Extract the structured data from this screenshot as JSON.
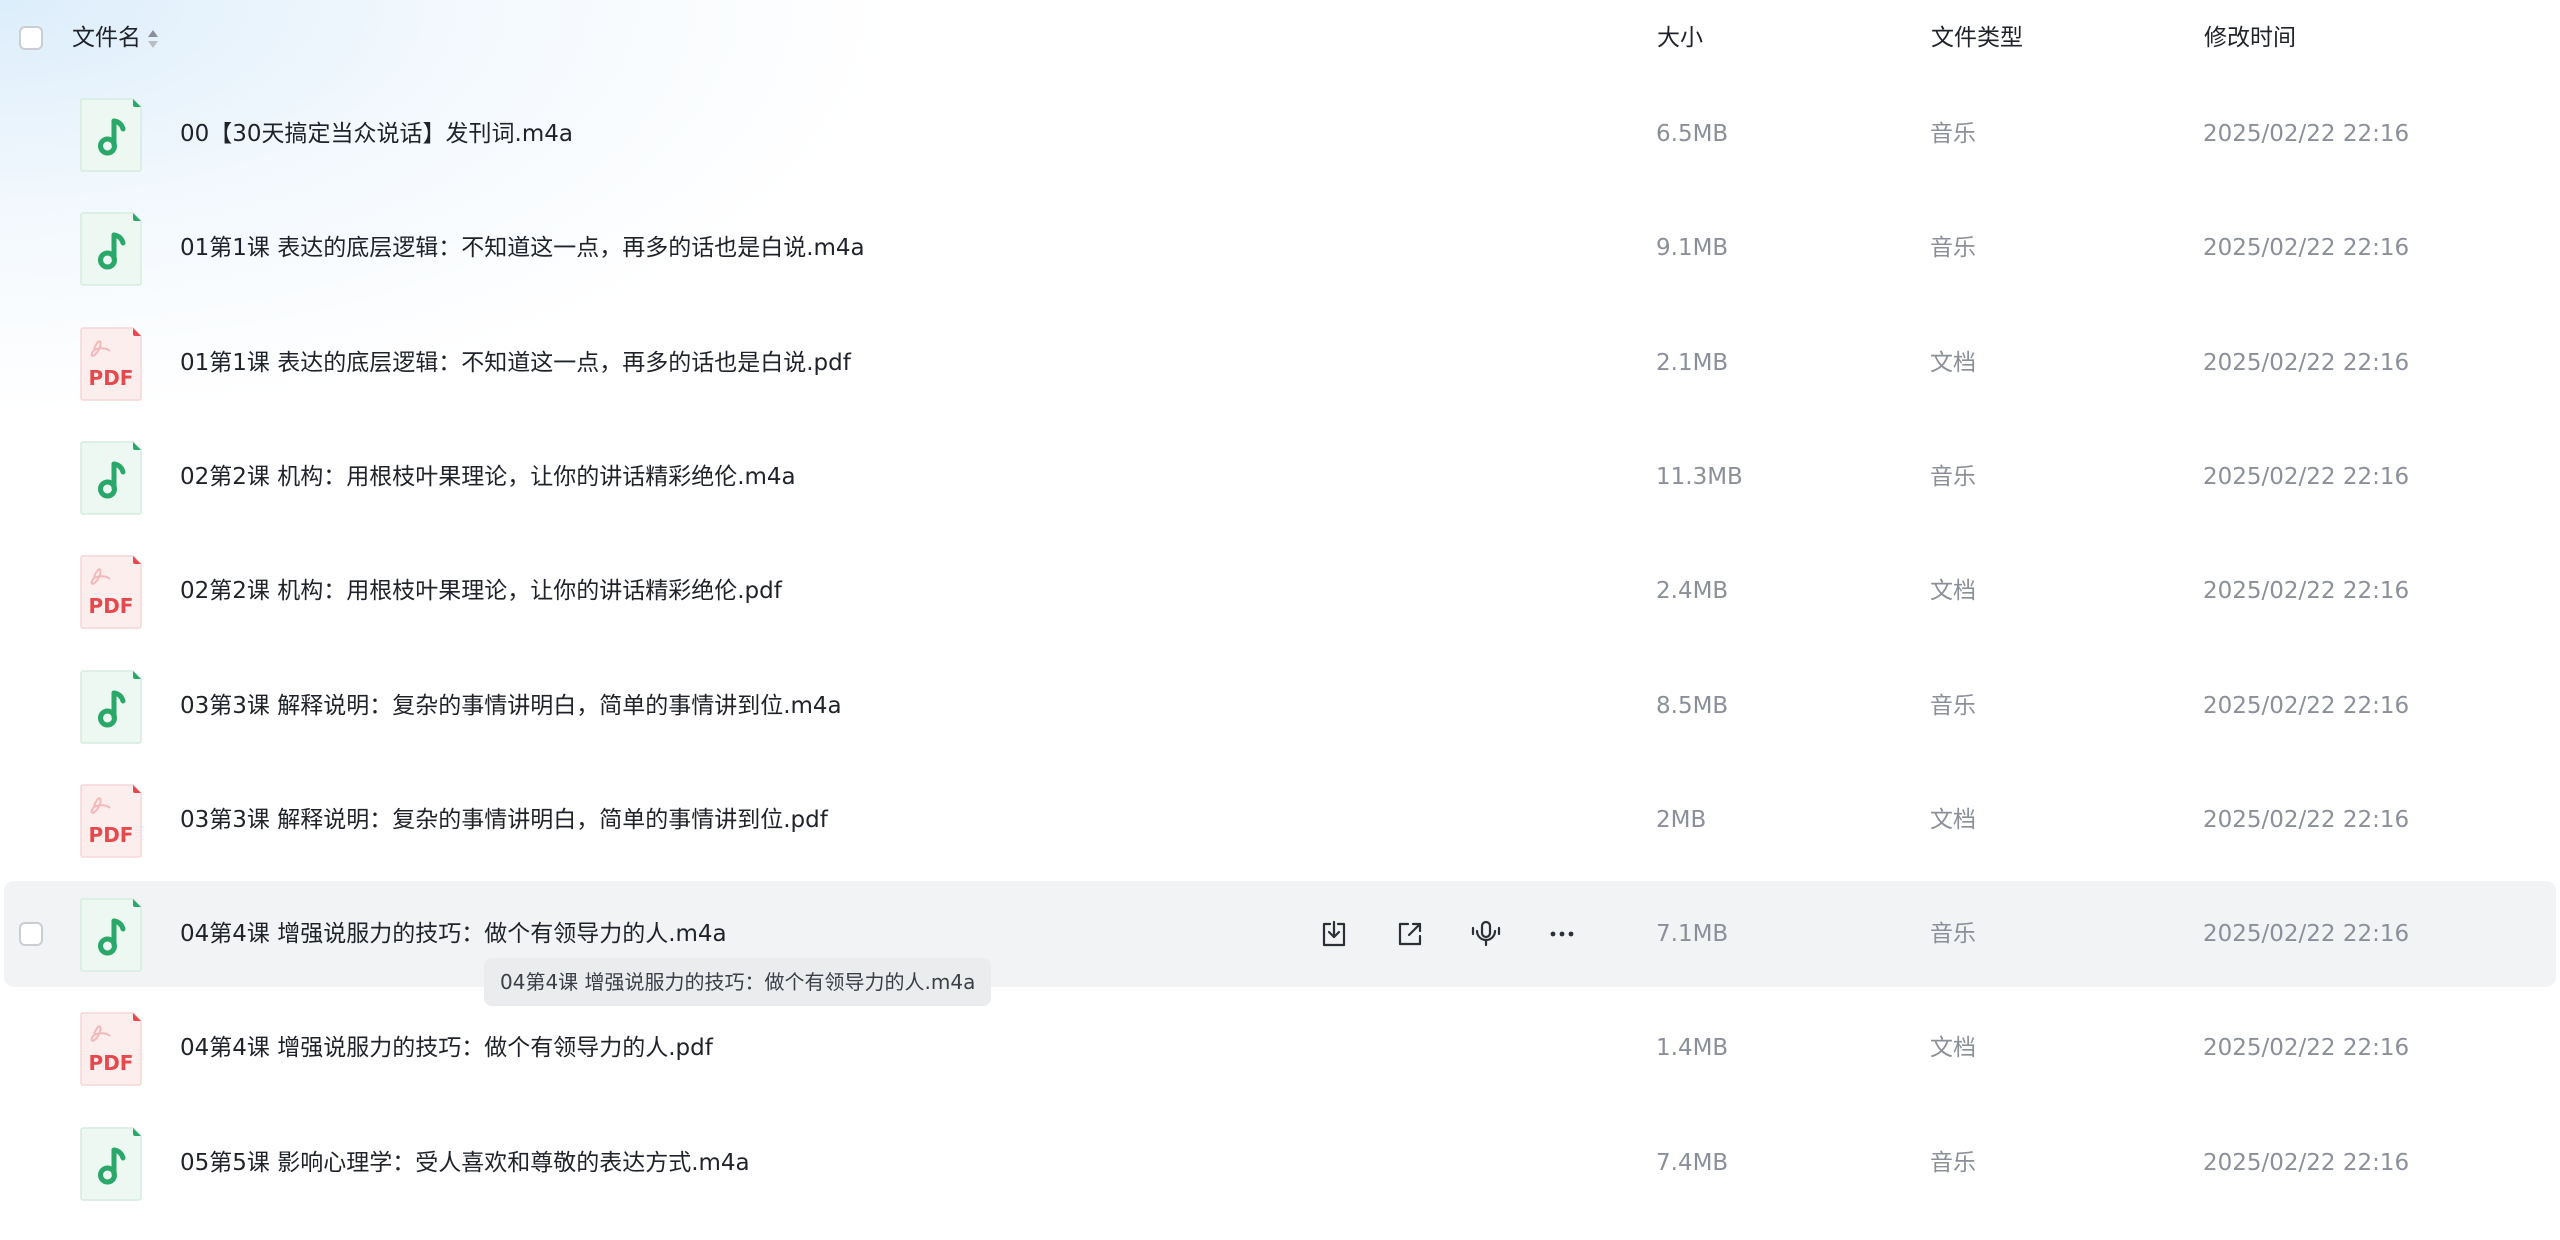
{
  "header": {
    "name_label": "文件名",
    "size_label": "大小",
    "type_label": "文件类型",
    "mtime_label": "修改时间"
  },
  "files": [
    {
      "name": "00【30天搞定当众说话】发刊词.m4a",
      "size": "6.5MB",
      "type": "音乐",
      "mtime": "2025/02/22 22:16",
      "icon": "music"
    },
    {
      "name": "01第1课 表达的底层逻辑：不知道这一点，再多的话也是白说.m4a",
      "size": "9.1MB",
      "type": "音乐",
      "mtime": "2025/02/22 22:16",
      "icon": "music"
    },
    {
      "name": "01第1课 表达的底层逻辑：不知道这一点，再多的话也是白说.pdf",
      "size": "2.1MB",
      "type": "文档",
      "mtime": "2025/02/22 22:16",
      "icon": "pdf"
    },
    {
      "name": "02第2课 机构：用根枝叶果理论，让你的讲话精彩绝伦.m4a",
      "size": "11.3MB",
      "type": "音乐",
      "mtime": "2025/02/22 22:16",
      "icon": "music"
    },
    {
      "name": "02第2课 机构：用根枝叶果理论，让你的讲话精彩绝伦.pdf",
      "size": "2.4MB",
      "type": "文档",
      "mtime": "2025/02/22 22:16",
      "icon": "pdf"
    },
    {
      "name": "03第3课 解释说明：复杂的事情讲明白，简单的事情讲到位.m4a",
      "size": "8.5MB",
      "type": "音乐",
      "mtime": "2025/02/22 22:16",
      "icon": "music"
    },
    {
      "name": "03第3课 解释说明：复杂的事情讲明白，简单的事情讲到位.pdf",
      "size": "2MB",
      "type": "文档",
      "mtime": "2025/02/22 22:16",
      "icon": "pdf"
    },
    {
      "name": "04第4课 增强说服力的技巧：做个有领导力的人.m4a",
      "size": "7.1MB",
      "type": "音乐",
      "mtime": "2025/02/22 22:16",
      "icon": "music"
    },
    {
      "name": "04第4课 增强说服力的技巧：做个有领导力的人.pdf",
      "size": "1.4MB",
      "type": "文档",
      "mtime": "2025/02/22 22:16",
      "icon": "pdf"
    },
    {
      "name": "05第5课 影响心理学：受人喜欢和尊敬的表达方式.m4a",
      "size": "7.4MB",
      "type": "音乐",
      "mtime": "2025/02/22 22:16",
      "icon": "music"
    }
  ],
  "icons": {
    "pdf_label": "PDF",
    "music_color": "#2aa86a",
    "pdf_color": "#e5484d"
  },
  "tooltip": {
    "text": "04第4课 增强说服力的技巧：做个有领导力的人.m4a"
  }
}
